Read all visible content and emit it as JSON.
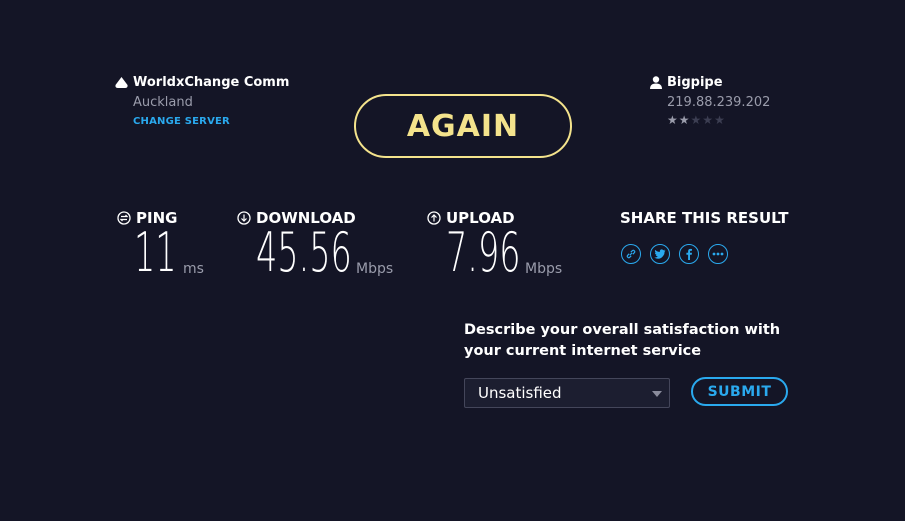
{
  "server": {
    "name": "WorldxChange Comm",
    "location": "Auckland",
    "change_label": "CHANGE SERVER"
  },
  "isp": {
    "name": "Bigpipe",
    "ip": "219.88.239.202",
    "rating": 2,
    "rating_max": 5
  },
  "again_label": "AGAIN",
  "metrics": {
    "ping": {
      "label": "PING",
      "value": "11",
      "unit": "ms"
    },
    "download": {
      "label": "DOWNLOAD",
      "value": "45.56",
      "unit": "Mbps"
    },
    "upload": {
      "label": "UPLOAD",
      "value": "7.96",
      "unit": "Mbps"
    }
  },
  "share": {
    "title": "SHARE THIS RESULT",
    "icons": [
      "link-icon",
      "twitter-icon",
      "facebook-icon",
      "more-icon"
    ]
  },
  "survey": {
    "question": "Describe your overall satisfaction with your current internet service",
    "selected": "Unsatisfied",
    "submit_label": "SUBMIT"
  },
  "colors": {
    "background": "#141526",
    "accent_yellow": "#f4e38c",
    "accent_blue": "#2aa9ee",
    "muted_text": "#9a9cab"
  }
}
